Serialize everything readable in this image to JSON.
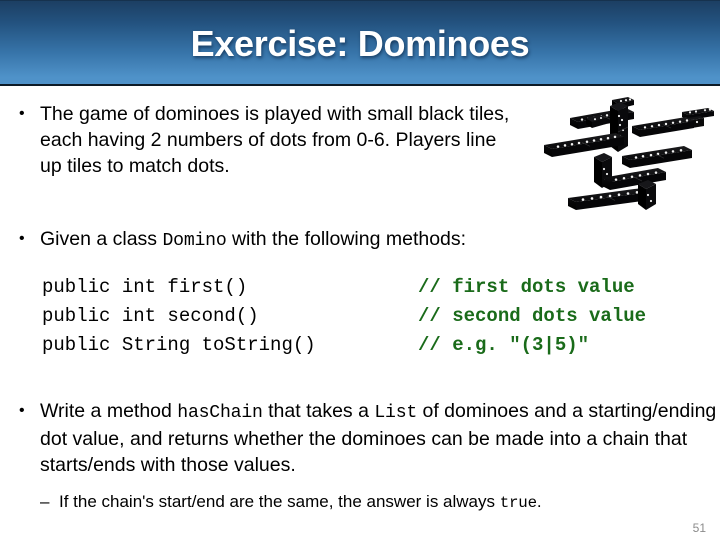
{
  "slide": {
    "title": "Exercise: Dominoes",
    "page_number": "51",
    "accent_header_top": "#1c3f63",
    "accent_header_bottom": "#4f92c9",
    "comment_color": "#1a6b1a"
  },
  "bullets": [
    {
      "marker": "•",
      "text": "The game of dominoes is played with small black tiles, each having 2 numbers of dots from 0-6.  Players line up tiles to match dots."
    },
    {
      "marker": "•",
      "prefix": "Given a class ",
      "code": "Domino",
      "suffix": " with the following methods:"
    },
    {
      "marker": "•",
      "part1": "Write a method ",
      "code1": "hasChain",
      "part2": " that takes a ",
      "code2": "List",
      "part3": " of dominoes and a starting/ending dot value, and returns whether the dominoes can be made into a chain that starts/ends with those values."
    }
  ],
  "sub_bullet": {
    "marker": "–",
    "part1": "If the chain's start/end are the same, the answer is always ",
    "code": "true",
    "part2": "."
  },
  "code_block": {
    "rows": [
      {
        "signature": "public int first()",
        "comment": "// first dots value"
      },
      {
        "signature": "public int second()",
        "comment": "// second dots value"
      },
      {
        "signature": "public String toString()",
        "comment": "// e.g. \"(3|5)\""
      }
    ]
  },
  "image": {
    "alt": "photograph of black domino tiles with white dots arranged in an interlocking chain pattern"
  }
}
